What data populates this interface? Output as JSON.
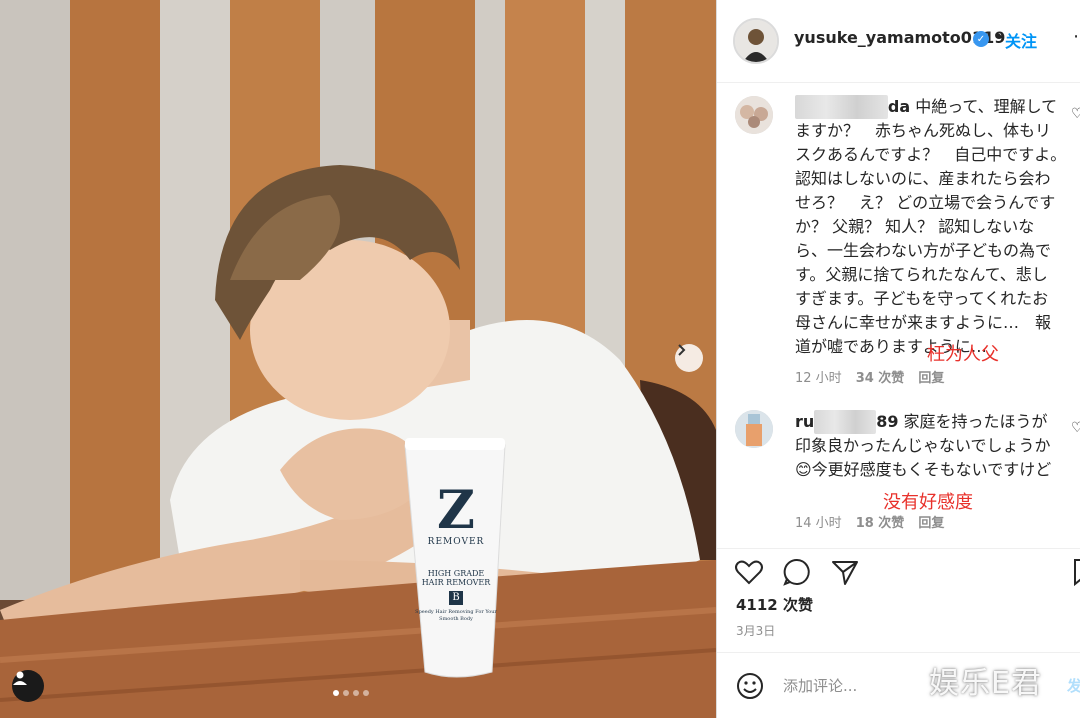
{
  "post": {
    "username": "yusuke_yamamoto0119",
    "separator": "•",
    "follow_label": "关注",
    "more_label": "⋯"
  },
  "photo": {
    "product_brand": "Z",
    "product_sub": "REMOVER",
    "product_line1": "HIGH GRADE",
    "product_line2": "HAIR REMOVER",
    "product_small": "Speedy Hair Removing For Your Smooth Body",
    "carousel_total": 4,
    "carousel_active": 1
  },
  "comments": [
    {
      "user_tail": "da",
      "text": " 中絶って、理解してますか？　赤ちゃん死ぬし、体もリスクあるんですよ？　自己中ですよ。　認知はしないのに、産まれたら会わせろ？　え？ どの立場で会うんですか？ 父親？ 知人？ 認知しないなら、一生会わない方が子どもの為です。父親に捨てられたなんて、悲しすぎます。子どもを守ってくれたお母さんに幸せが来ますように…　報道が嘘でありますように…",
      "time": "12 小时",
      "likes": "34 次赞",
      "reply": "回复",
      "annotation": "枉为人父"
    },
    {
      "user_head": "ru",
      "user_tail": "89",
      "text": " 家庭を持ったほうが印象良かったんじゃないでしょうか😊今更好感度もくそもないですけど",
      "time": "14 小时",
      "likes": "18 次赞",
      "reply": "回复",
      "annotation": "没有好感度"
    }
  ],
  "stats": {
    "likes": "4112 次赞",
    "date": "3月3日"
  },
  "comment_box": {
    "placeholder": "添加评论...",
    "publish": "发",
    "watermark": "娱乐E君"
  }
}
